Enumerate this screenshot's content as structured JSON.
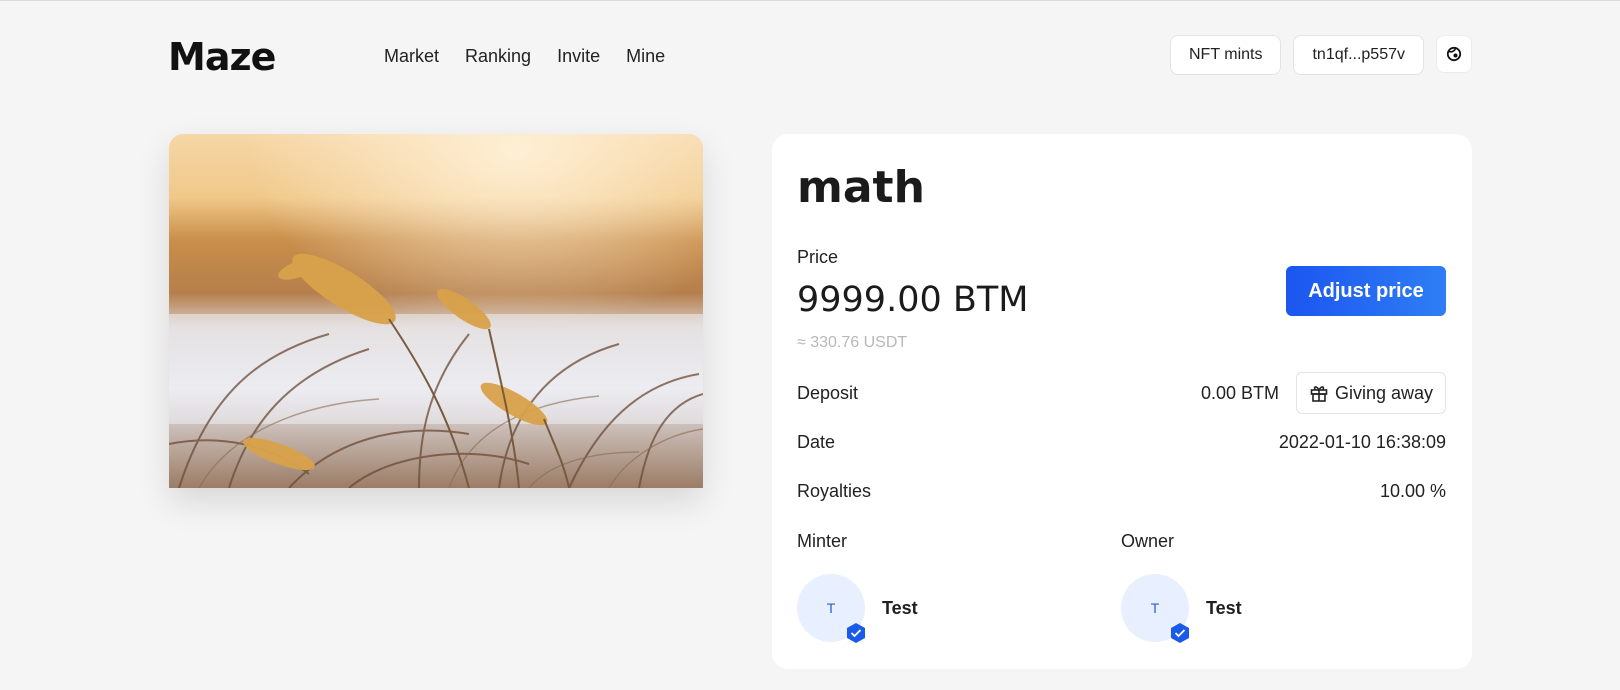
{
  "brand": {
    "logo": "Maze"
  },
  "nav": {
    "items": [
      {
        "label": "Market"
      },
      {
        "label": "Ranking"
      },
      {
        "label": "Invite"
      },
      {
        "label": "Mine"
      }
    ]
  },
  "header": {
    "nft_mints": "NFT mints",
    "wallet": "tn1qf...p557v",
    "settings_icon": "settings-icon"
  },
  "nft": {
    "title": "math",
    "price_label": "Price",
    "price": "9999.00 BTM",
    "price_usdt": "≈ 330.76 USDT",
    "adjust_price": "Adjust price",
    "deposit_label": "Deposit",
    "deposit_value": "0.00 BTM",
    "giving_away": "Giving away",
    "date_label": "Date",
    "date_value": "2022-01-10 16:38:09",
    "royalties_label": "Royalties",
    "royalties_value": "10.00 %",
    "minter_label": "Minter",
    "minter": {
      "initial": "T",
      "name": "Test"
    },
    "owner_label": "Owner",
    "owner": {
      "initial": "T",
      "name": "Test"
    }
  },
  "colors": {
    "accent": "#1b56f0",
    "background": "#f5f5f5"
  }
}
